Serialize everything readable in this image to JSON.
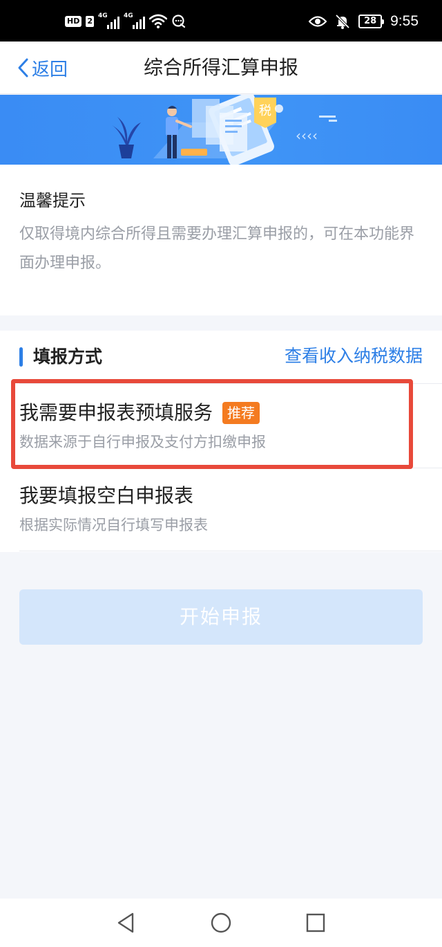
{
  "status_bar": {
    "hd": "HD",
    "sim": "2",
    "signal1": "4G",
    "signal2": "4G",
    "battery": "28",
    "time": "9:55"
  },
  "nav": {
    "back_label": "返回",
    "title": "综合所得汇算申报"
  },
  "banner": {
    "tax_char": "税"
  },
  "tips": {
    "title": "温馨提示",
    "text": "仅取得境内综合所得且需要办理汇算申报的，可在本功能界面办理申报。"
  },
  "method": {
    "title": "填报方式",
    "link": "查看收入纳税数据",
    "options": [
      {
        "title": "我需要申报表预填服务",
        "badge": "推荐",
        "desc": "数据来源于自行申报及支付方扣缴申报"
      },
      {
        "title": "我要填报空白申报表",
        "desc": "根据实际情况自行填写申报表"
      }
    ]
  },
  "submit_label": "开始申报",
  "colors": {
    "accent": "#2d7fe6",
    "badge": "#f47b20",
    "highlight": "#e8493a",
    "button_disabled": "#d4e6fb"
  }
}
